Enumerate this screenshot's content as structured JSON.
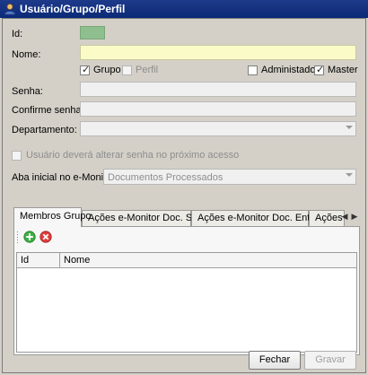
{
  "window": {
    "title": "Usuário/Grupo/Perfil"
  },
  "form": {
    "id_label": "Id:",
    "nome_label": "Nome:",
    "grupo_label": "Grupo",
    "grupo_checked": true,
    "perfil_label": "Perfil",
    "perfil_checked": false,
    "administrador_label": "Administador",
    "administrador_checked": false,
    "master_label": "Master",
    "master_checked": true,
    "senha_label": "Senha:",
    "confirme_label": "Confirme senha:",
    "departamento_label": "Departamento:",
    "alterar_senha_label": "Usuário deverá alterar senha no próximo acesso",
    "alterar_senha_checked": false,
    "aba_label": "Aba inicial no e-Monitor:",
    "aba_value": "Documentos Processados"
  },
  "tabs": [
    {
      "label": "Membros Grupo",
      "active": true
    },
    {
      "label": "Ações e-Monitor Doc. Saída",
      "active": false
    },
    {
      "label": "Ações e-Monitor Doc. Entrada",
      "active": false
    },
    {
      "label": "Ações e-M",
      "active": false
    }
  ],
  "grid": {
    "columns": [
      "Id",
      "Nome"
    ]
  },
  "buttons": {
    "fechar": "Fechar",
    "gravar": "Gravar"
  },
  "colors": {
    "id_box": "#8fbf8f",
    "nome_field": "#fbfbc8",
    "title_bar": "#0b2a78"
  },
  "icons": {
    "add": "add-icon",
    "remove": "remove-icon",
    "window": "user-icon"
  }
}
